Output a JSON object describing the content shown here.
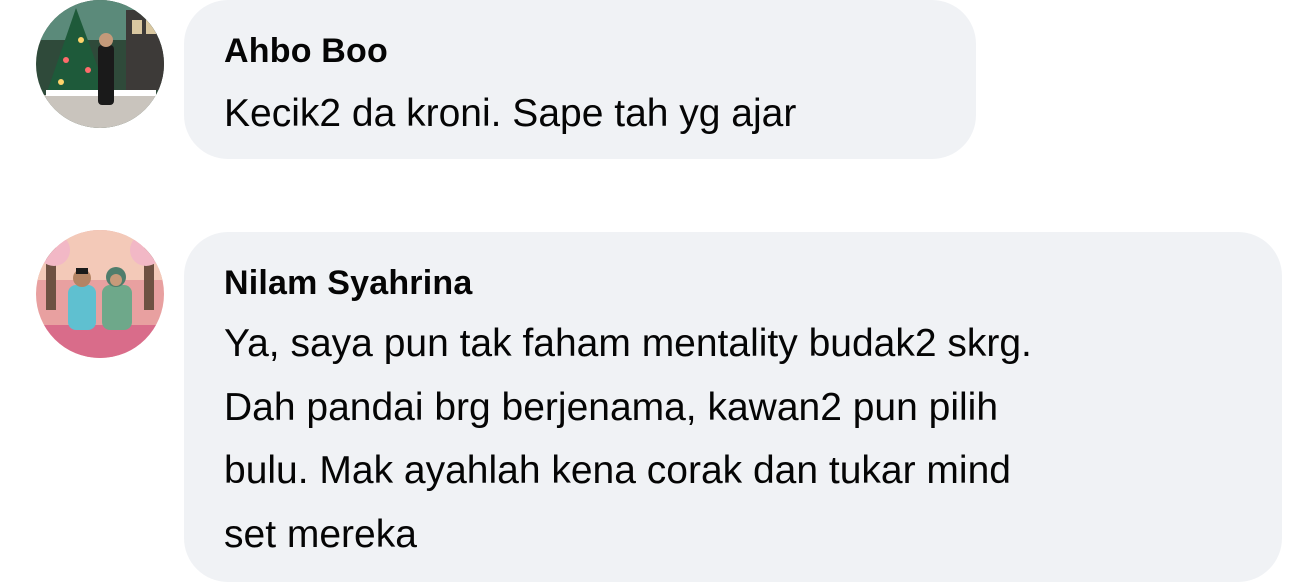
{
  "comments": [
    {
      "author": "Ahbo Boo",
      "avatar_icon": "profile-photo-christmas-tree",
      "lines": [
        "Kecik2 da kroni. Sape tah yg ajar"
      ]
    },
    {
      "author": "Nilam Syahrina",
      "avatar_icon": "profile-photo-couple-flowers",
      "lines": [
        "Ya, saya pun tak faham mentality budak2 skrg.",
        "Dah pandai brg berjenama, kawan2 pun pilih",
        "bulu. Mak ayahlah kena corak dan tukar mind",
        "set mereka"
      ]
    }
  ],
  "colors": {
    "bubble_bg": "#f0f2f5",
    "text": "#050505"
  }
}
